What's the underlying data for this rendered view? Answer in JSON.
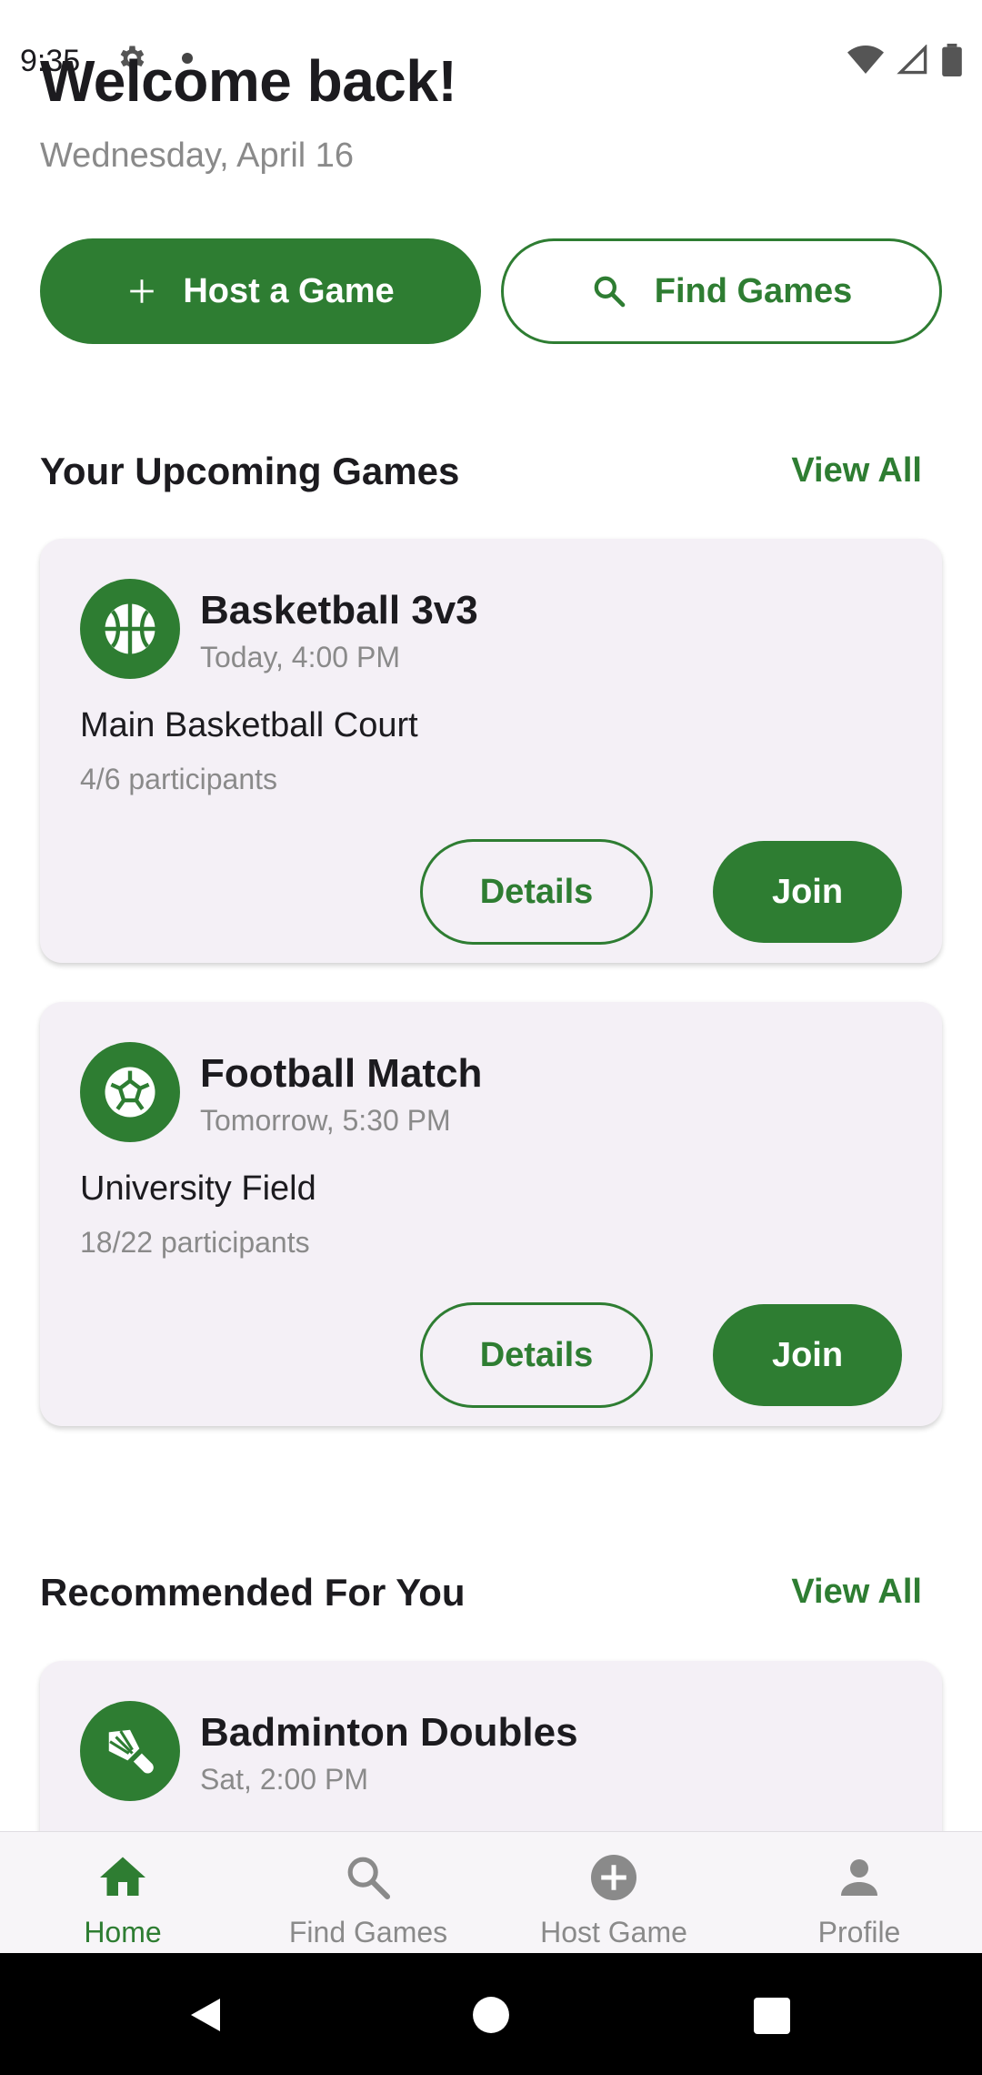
{
  "status_bar": {
    "time": "9:35"
  },
  "header": {
    "title": "Welcome back!",
    "date": "Wednesday, April 16"
  },
  "actions": {
    "host_label": "Host a Game",
    "find_label": "Find Games"
  },
  "upcoming": {
    "title": "Your Upcoming Games",
    "view_all": "View All",
    "games": [
      {
        "icon": "basketball-icon",
        "title": "Basketball 3v3",
        "time": "Today, 4:00 PM",
        "location": "Main Basketball Court",
        "participants": "4/6 participants",
        "details_label": "Details",
        "join_label": "Join"
      },
      {
        "icon": "soccer-ball-icon",
        "title": "Football Match",
        "time": "Tomorrow, 5:30 PM",
        "location": "University Field",
        "participants": "18/22 participants",
        "details_label": "Details",
        "join_label": "Join"
      }
    ]
  },
  "recommended": {
    "title": "Recommended For You",
    "view_all": "View All",
    "games": [
      {
        "icon": "shuttlecock-icon",
        "title": "Badminton Doubles",
        "time": "Sat, 2:00 PM"
      }
    ]
  },
  "bottom_nav": {
    "items": [
      {
        "label": "Home",
        "icon": "home-icon",
        "active": true
      },
      {
        "label": "Find Games",
        "icon": "search-icon",
        "active": false
      },
      {
        "label": "Host Game",
        "icon": "add-circle-icon",
        "active": false
      },
      {
        "label": "Profile",
        "icon": "person-icon",
        "active": false
      }
    ]
  },
  "colors": {
    "primary": "#2e7d32",
    "card_background": "#f4f0f6",
    "muted_text": "#8a8a8a"
  }
}
